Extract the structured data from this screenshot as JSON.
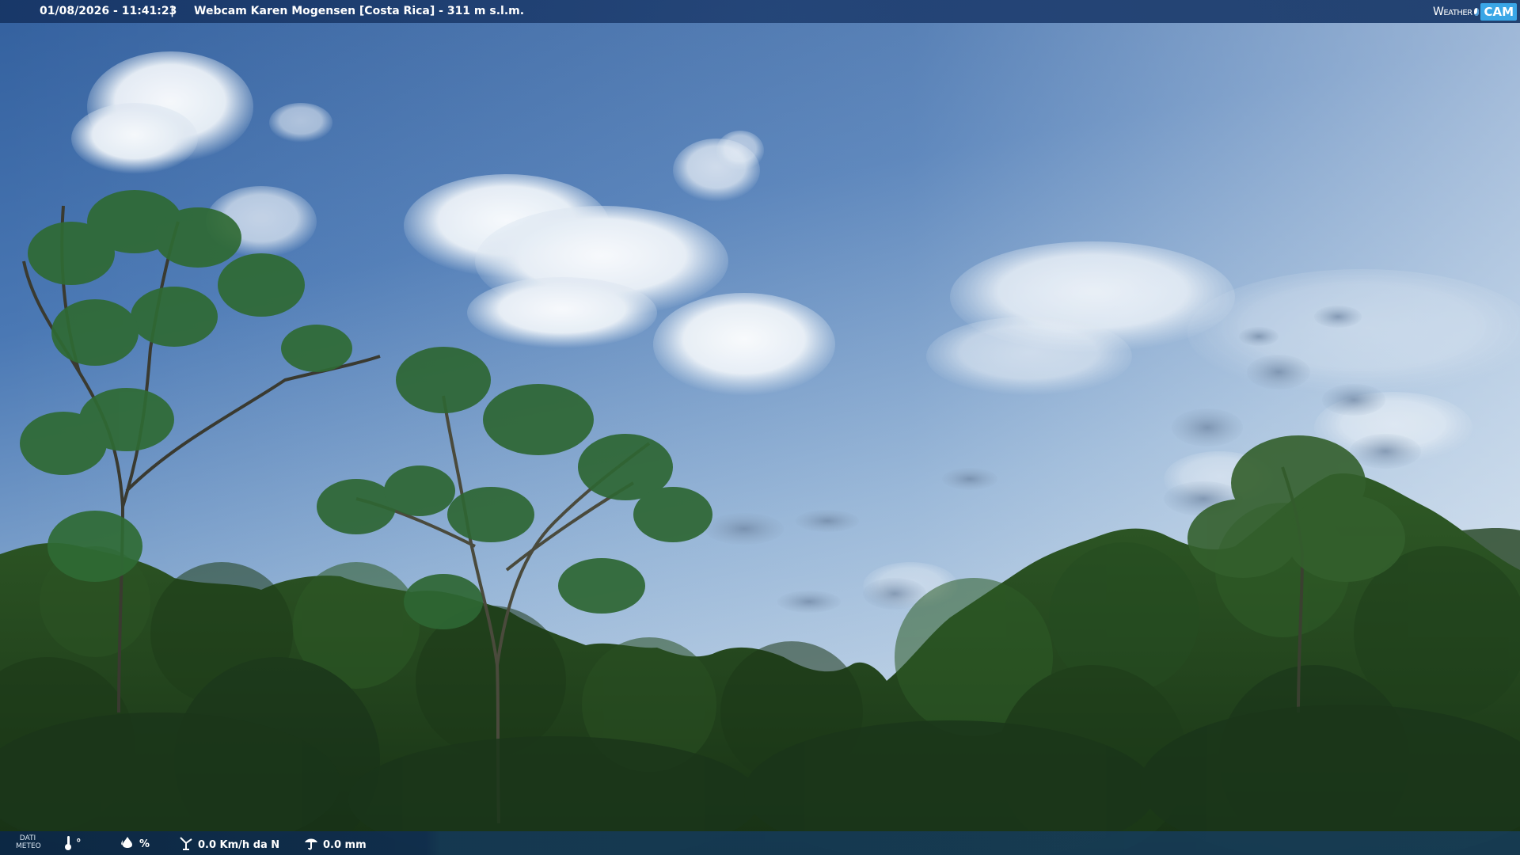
{
  "overlay": {
    "datetime": "01/08/2026 - 11:41:23",
    "separator": "|",
    "title": "Webcam Karen Mogensen [Costa Rica] - 311 m s.l.m."
  },
  "logo": {
    "weather_text": "Weather",
    "cam_text": "CAM"
  },
  "weather_data": {
    "label_line1": "DATI",
    "label_line2": "METEO",
    "temperature_text": "°",
    "humidity_text": "%",
    "wind_text": "0.0 Km/h da N",
    "rain_text": "0.0 mm"
  },
  "icons": {
    "temperature": "thermometer-icon",
    "humidity": "humidity-drop-icon",
    "wind": "wind-icon",
    "rain": "rain-icon"
  },
  "colors": {
    "sky_top": "#3d6aa8",
    "sky_horizon": "#b8cfe4",
    "forest_dark": "#1d3a18",
    "forest_mid": "#2f5a26",
    "overlay_bar": "#163464",
    "logo_accent": "#3aa6e6"
  }
}
